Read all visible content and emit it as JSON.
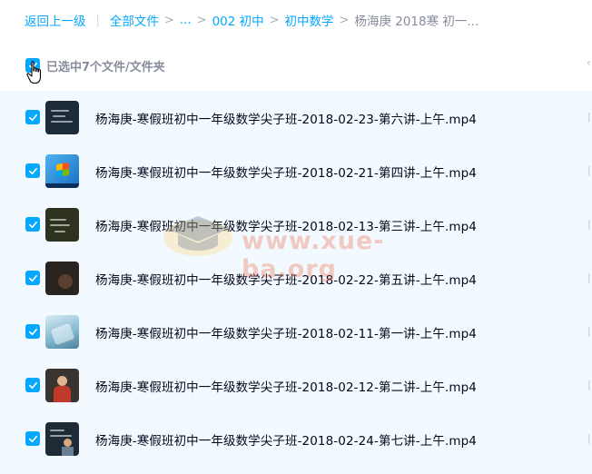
{
  "breadcrumb": {
    "back": "返回上一级",
    "divider": "|",
    "sep": ">",
    "items": [
      "全部文件",
      "...",
      "002 初中",
      "初中数学"
    ],
    "current": "杨海庚 2018寒 初一..."
  },
  "selection": {
    "count_label": "已选中7个文件/文件夹",
    "checked": true
  },
  "files": [
    {
      "name": "杨海庚-寒假班初中一年级数学尖子班-2018-02-23-第六讲-上午.mp4",
      "checked": true
    },
    {
      "name": "杨海庚-寒假班初中一年级数学尖子班-2018-02-21-第四讲-上午.mp4",
      "checked": true
    },
    {
      "name": "杨海庚-寒假班初中一年级数学尖子班-2018-02-13-第三讲-上午.mp4",
      "checked": true
    },
    {
      "name": "杨海庚-寒假班初中一年级数学尖子班-2018-02-22-第五讲-上午.mp4",
      "checked": true
    },
    {
      "name": "杨海庚-寒假班初中一年级数学尖子班-2018-02-11-第一讲-上午.mp4",
      "checked": true
    },
    {
      "name": "杨海庚-寒假班初中一年级数学尖子班-2018-02-12-第二讲-上午.mp4",
      "checked": true
    },
    {
      "name": "杨海庚-寒假班初中一年级数学尖子班-2018-02-24-第七讲-上午.mp4",
      "checked": true
    }
  ],
  "watermark": {
    "text": "www.xue-ba.org"
  },
  "colors": {
    "accent": "#06a7ff",
    "row_bg": "#f3faff",
    "muted": "#878c9c"
  }
}
